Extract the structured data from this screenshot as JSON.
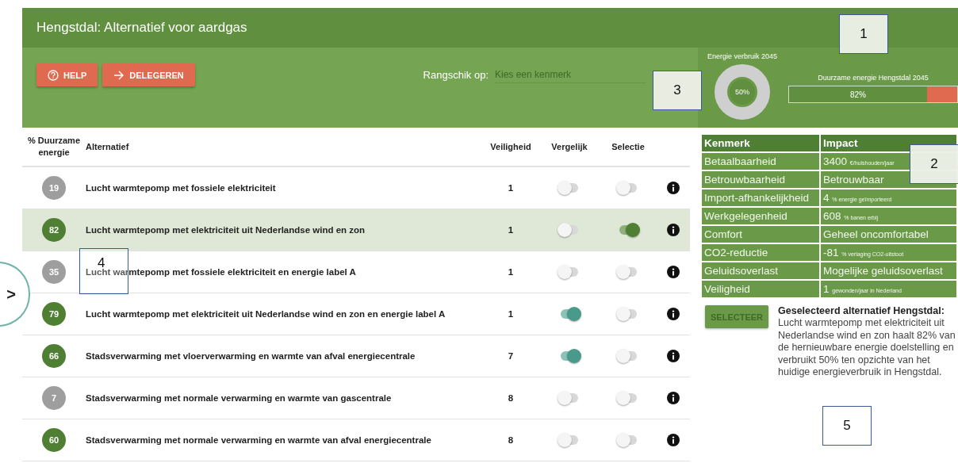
{
  "window": {
    "title": "Hengstdal: Alternatief voor aardgas"
  },
  "toolbar": {
    "buttons": [
      {
        "kind": "help",
        "label": "HELP"
      },
      {
        "kind": "delegate",
        "label": "DELEGEREN"
      }
    ],
    "sort_label": "Rangschik op:",
    "sort_field": {
      "placeholder": "Kies een kenmerk"
    }
  },
  "energy_use": {
    "title": "Energie verbruik 2045",
    "reading": "50%"
  },
  "sustainable_energy": {
    "title": "Duurzame energie Hengstdal 2045",
    "reading": "82%",
    "level": 0.82
  },
  "table": {
    "columns": [
      "% Duurzame energie",
      "Alternatief",
      "Veiligheid",
      "Vergelijk",
      "Selectie"
    ],
    "rows": [
      {
        "score": "19",
        "color": "#9e9e9e",
        "name": "Lucht warmtepomp met fossiele elektriciteit",
        "safety": "1",
        "compare": false,
        "selected": false
      },
      {
        "score": "82",
        "color": "#4f7f32",
        "name": "Lucht warmtepomp met elektriciteit uit Nederlandse wind en zon",
        "safety": "1",
        "compare": false,
        "selected": true
      },
      {
        "score": "35",
        "color": "#9e9e9e",
        "name": "Lucht warmtepomp met fossiele elektriciteit en energie label A",
        "safety": "1",
        "compare": false,
        "selected": false
      },
      {
        "score": "79",
        "color": "#4f7f32",
        "name": "Lucht warmtepomp met elektriciteit uit Nederlandse wind en zon en energie label A",
        "safety": "1",
        "compare": true,
        "selected": false
      },
      {
        "score": "66",
        "color": "#4f7f32",
        "name": "Stadsverwarming met vloerverwarming en warmte van afval energiecentrale",
        "safety": "7",
        "compare": true,
        "selected": false
      },
      {
        "score": "7",
        "color": "#9e9e9e",
        "name": "Stadsverwarming met normale verwarming en warmte van gascentrale",
        "safety": "8",
        "compare": false,
        "selected": false
      },
      {
        "score": "60",
        "color": "#4f7f32",
        "name": "Stadsverwarming met normale verwarming en warmte van afval energiecentrale",
        "safety": "8",
        "compare": false,
        "selected": false
      }
    ]
  },
  "side_toggle": ">",
  "impact": {
    "columns": [
      "Kenmerk",
      "Impact"
    ],
    "rows": [
      {
        "feature": "Betaalbaarheid",
        "value": "3400",
        "unit": "€/huishouden/jaar"
      },
      {
        "feature": "Betrouwbaarheid",
        "value": "Betrouwbaar"
      },
      {
        "feature": "Import-afhankelijkheid",
        "value": "4",
        "unit": "% energie geïmporteerd"
      },
      {
        "feature": "Werkgelegenheid",
        "value": "608",
        "unit": "% banen erbij"
      },
      {
        "feature": "Comfort",
        "value": "Geheel oncomfortabel"
      },
      {
        "feature": "CO2-reductie",
        "value": "-81",
        "unit": "% verlaging CO2-uitstoot"
      },
      {
        "feature": "Geluidsoverlast",
        "value": "Mogelijke geluidsoverlast"
      },
      {
        "feature": "Veiligheid",
        "value": "1",
        "unit": "gewonden/jaar in Nederland"
      }
    ]
  },
  "select_button": "SELECTEER",
  "selection_note": {
    "title": "Geselecteerd alternatief Hengstdal:",
    "text": "Lucht warmtepomp met elektriciteit uit Nederlandse wind en zon haalt 82% van de hernieuwbare energie doelstelling en verbruikt 50% ten opzichte van het huidige energieverbruik in Hengstdal."
  },
  "annotations": [
    "1",
    "2",
    "3",
    "4",
    "5"
  ]
}
